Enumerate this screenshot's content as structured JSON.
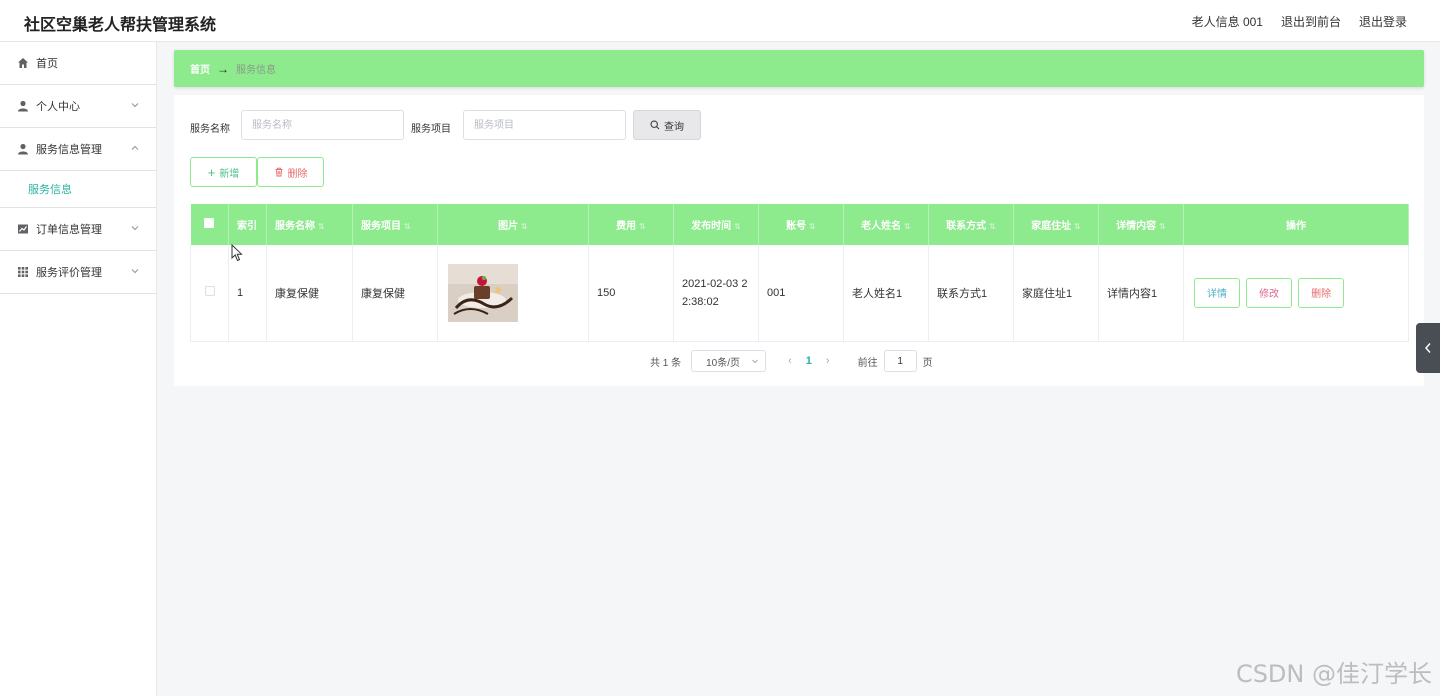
{
  "header": {
    "title": "社区空巢老人帮扶管理系统",
    "user_info": "老人信息 001",
    "exit_front": "退出到前台",
    "logout": "退出登录"
  },
  "sidebar": {
    "items": [
      {
        "label": "首页",
        "icon": "home-icon"
      },
      {
        "label": "个人中心",
        "icon": "user-icon"
      },
      {
        "label": "服务信息管理",
        "icon": "user-icon"
      },
      {
        "label": "订单信息管理",
        "icon": "chart-icon"
      },
      {
        "label": "服务评价管理",
        "icon": "grid-icon"
      }
    ],
    "submenu": "服务信息"
  },
  "breadcrumb": {
    "home": "首页",
    "arrow": "→",
    "current": "服务信息"
  },
  "search": {
    "name_label": "服务名称",
    "name_placeholder": "服务名称",
    "item_label": "服务项目",
    "item_placeholder": "服务项目",
    "query_button": "查询"
  },
  "actions": {
    "add": "新增",
    "delete": "删除"
  },
  "table": {
    "columns": [
      "索引",
      "服务名称",
      "服务项目",
      "图片",
      "费用",
      "发布时间",
      "账号",
      "老人姓名",
      "联系方式",
      "家庭住址",
      "详情内容",
      "操作"
    ],
    "rows": [
      {
        "index": "1",
        "service_name": "康复保健",
        "service_item": "康复保健",
        "fee": "150",
        "publish_time": "2021-02-03 22:38:02",
        "account": "001",
        "elder_name": "老人姓名1",
        "contact": "联系方式1",
        "address": "家庭住址1",
        "detail": "详情内容1",
        "ops": {
          "detail": "详情",
          "edit": "修改",
          "delete": "删除"
        }
      }
    ]
  },
  "pagination": {
    "total": "共 1 条",
    "page_size": "10条/页",
    "current_page": "1",
    "goto_label": "前往",
    "goto_value": "1",
    "page_suffix": "页"
  },
  "watermark": "CSDN @佳汀学长",
  "colors": {
    "accent_green": "#8dea8d",
    "teal_text": "#2bb3a0",
    "danger": "#e86a6a",
    "pink": "#e06690"
  }
}
